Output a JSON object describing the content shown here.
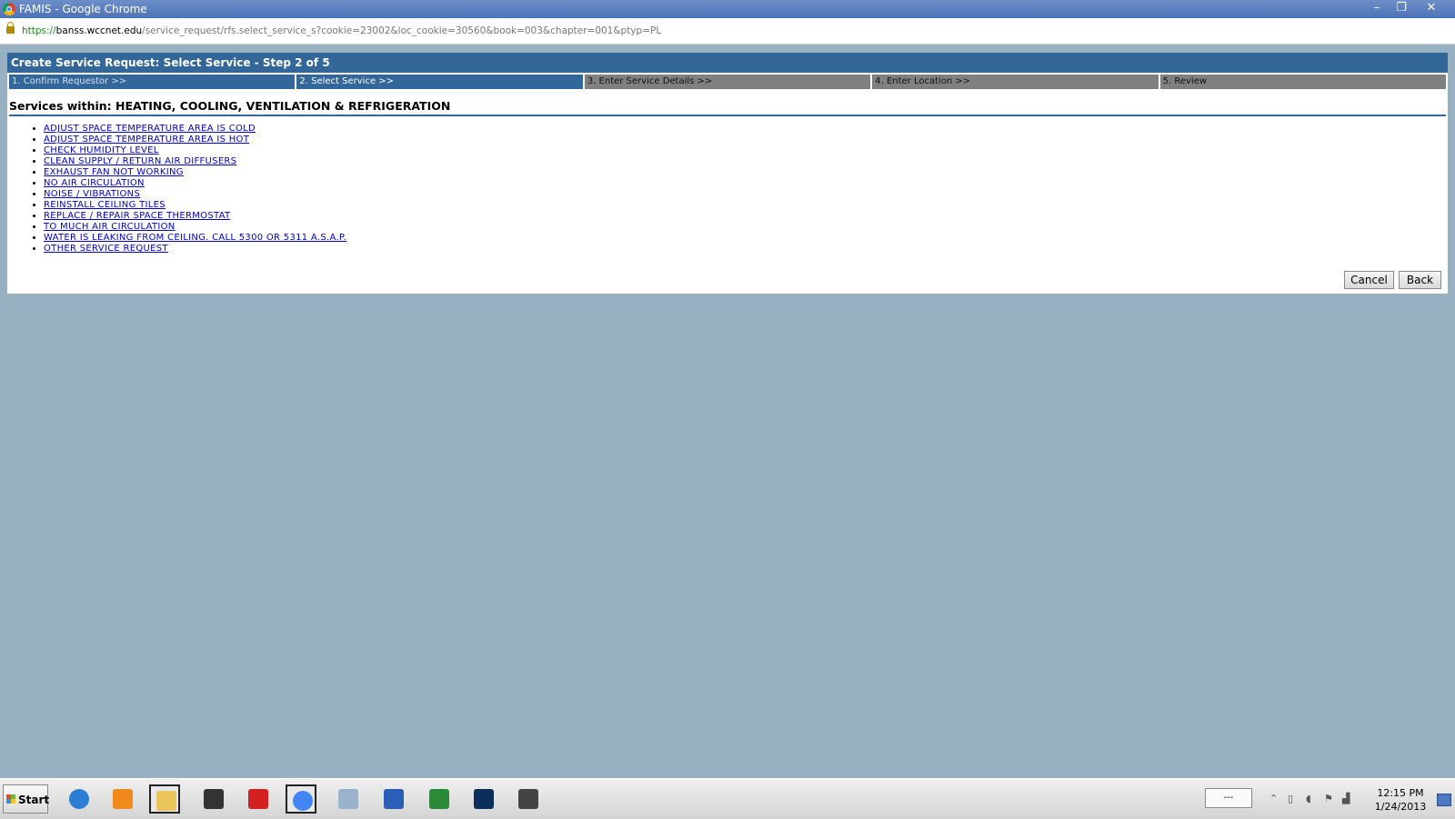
{
  "window": {
    "title": "FAMIS - Google Chrome",
    "controls": {
      "minimize": "–",
      "restore": "❐",
      "close": "✕"
    }
  },
  "address_bar": {
    "scheme": "https://",
    "host": "banss.wccnet.edu",
    "path": "/service_request/rfs.select_service_s?cookie=23002&loc_cookie=30560&book=003&chapter=001&ptyp=PL"
  },
  "page": {
    "header": "Create Service Request: Select Service - Step 2 of 5",
    "steps": [
      {
        "label": "1. Confirm Requestor >>",
        "state": "done"
      },
      {
        "label": "2. Select Service >>",
        "state": "current"
      },
      {
        "label": "3. Enter Service Details >>",
        "state": "todo"
      },
      {
        "label": "4. Enter Location >>",
        "state": "todo"
      },
      {
        "label": "5. Review",
        "state": "todo"
      }
    ],
    "section_title": "Services within: HEATING, COOLING, VENTILATION & REFRIGERATION",
    "services": [
      "ADJUST SPACE TEMPERATURE AREA IS COLD",
      "ADJUST SPACE TEMPERATURE AREA IS HOT",
      "CHECK HUMIDITY LEVEL",
      "CLEAN SUPPLY / RETURN AIR DIFFUSERS",
      "EXHAUST FAN NOT WORKING",
      "NO AIR CIRCULATION",
      "NOISE / VIBRATIONS",
      "REINSTALL CEILING TILES",
      "REPLACE / REPAIR SPACE THERMOSTAT",
      "TO MUCH AIR CIRCULATION",
      "WATER IS LEAKING FROM CEILING. CALL 5300 OR 5311 A.S.A.P.",
      "OTHER SERVICE REQUEST"
    ],
    "buttons": {
      "cancel": "Cancel",
      "back": "Back"
    }
  },
  "taskbar": {
    "start_label": "Start",
    "apps": [
      {
        "name": "internet-explorer-icon",
        "color": "#2a7fd4"
      },
      {
        "name": "media-player-icon",
        "color": "#f08a1c"
      },
      {
        "name": "file-explorer-icon",
        "color": "#e8c45a"
      },
      {
        "name": "scanner-icon",
        "color": "#333333"
      },
      {
        "name": "acrobat-icon",
        "color": "#d42020"
      },
      {
        "name": "chrome-icon",
        "color": "#4285f4"
      },
      {
        "name": "calculator-icon",
        "color": "#9ab3cc"
      },
      {
        "name": "word-icon",
        "color": "#2b5eb5"
      },
      {
        "name": "spreadsheet-icon",
        "color": "#2a8a3a"
      },
      {
        "name": "photoshop-icon",
        "color": "#0b2e5a"
      },
      {
        "name": "device-icon",
        "color": "#444444"
      }
    ],
    "tray_box": "---",
    "clock": {
      "time": "12:15 PM",
      "date": "1/24/2013"
    }
  }
}
